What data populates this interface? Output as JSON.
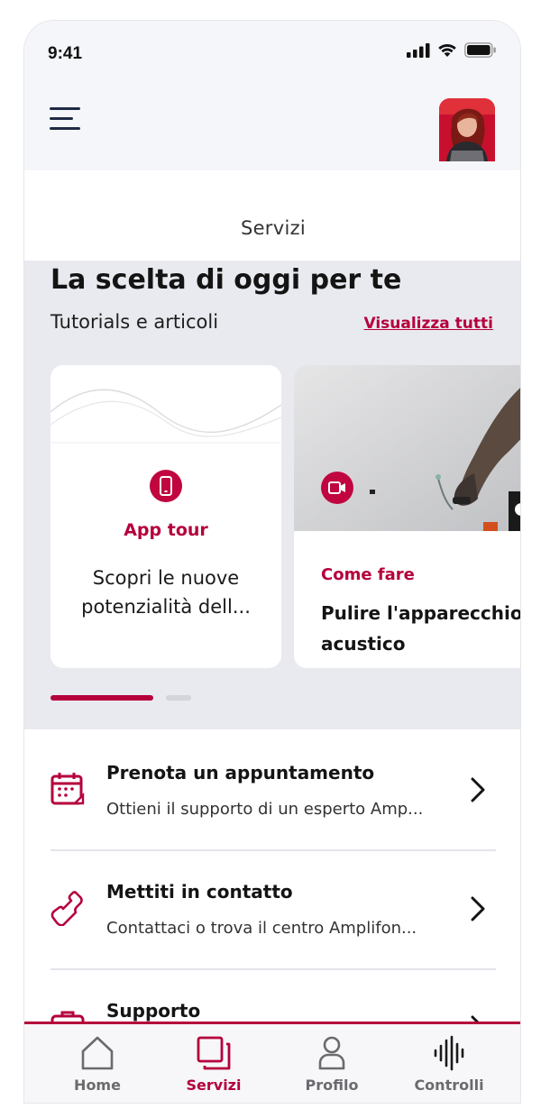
{
  "status_bar": {
    "time": "9:41"
  },
  "header": {
    "page_title": "Servizi"
  },
  "picks": {
    "title": "La scelta di oggi per te",
    "subtitle": "Tutorials e articoli",
    "see_all": "Visualizza tutti",
    "cards": [
      {
        "icon": "phone-icon",
        "category": "App tour",
        "description": "Scopri le nuove potenzialità dell..."
      },
      {
        "icon": "video-icon",
        "category": "Come fare",
        "description": "Pulire l'apparecchio acustico"
      }
    ],
    "carousel": {
      "active_index": 0,
      "page_count": 2
    }
  },
  "services": [
    {
      "icon": "calendar-icon",
      "title": "Prenota un appuntamento",
      "subtitle": "Ottieni il supporto di un esperto Amp..."
    },
    {
      "icon": "phone-handset-icon",
      "title": "Mettiti in contatto",
      "subtitle": "Contattaci o trova il centro Amplifon..."
    },
    {
      "icon": "support-icon",
      "title": "Supporto",
      "subtitle": ""
    }
  ],
  "tabbar": {
    "active": "Servizi",
    "tabs": [
      {
        "label": "Home",
        "icon": "home-icon"
      },
      {
        "label": "Servizi",
        "icon": "services-icon"
      },
      {
        "label": "Profilo",
        "icon": "profile-icon"
      },
      {
        "label": "Controlli",
        "icon": "equalizer-icon"
      }
    ]
  },
  "colors": {
    "accent": "#b5003c",
    "surface": "#e9eaef",
    "header_bg": "#f5f6f9"
  }
}
